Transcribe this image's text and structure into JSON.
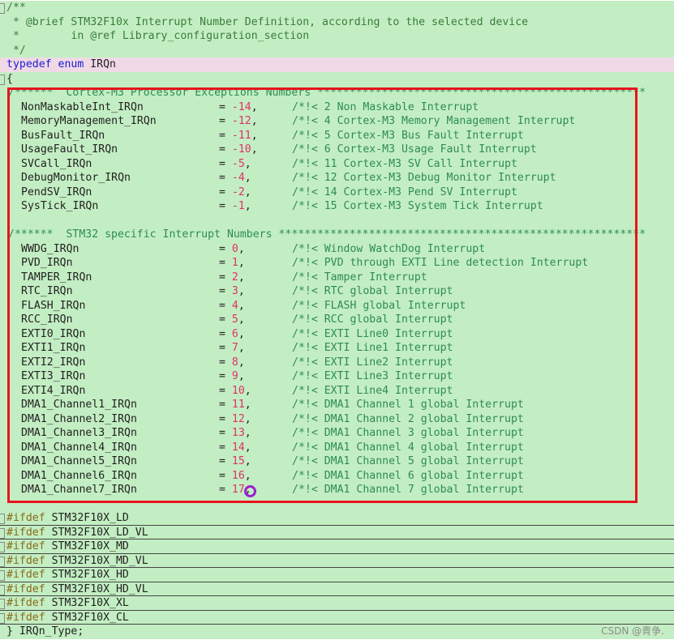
{
  "header_comment": [
    "/**",
    " * @brief STM32F10x Interrupt Number Definition, according to the selected device",
    " *        in @ref Library_configuration_section",
    " */"
  ],
  "typedef_line": {
    "keyword": "typedef enum",
    "name": " IRQn"
  },
  "open_brace": "{",
  "cortex_section_comment": "/******  Cortex-M3 Processor Exceptions Numbers ***************************************************",
  "cortex_entries": [
    {
      "name": "NonMaskableInt_IRQn",
      "value": "-14",
      "comment": "/*!< 2 Non Maskable Interrupt"
    },
    {
      "name": "MemoryManagement_IRQn",
      "value": "-12",
      "comment": "/*!< 4 Cortex-M3 Memory Management Interrupt"
    },
    {
      "name": "BusFault_IRQn",
      "value": "-11",
      "comment": "/*!< 5 Cortex-M3 Bus Fault Interrupt"
    },
    {
      "name": "UsageFault_IRQn",
      "value": "-10",
      "comment": "/*!< 6 Cortex-M3 Usage Fault Interrupt"
    },
    {
      "name": "SVCall_IRQn",
      "value": "-5",
      "comment": "/*!< 11 Cortex-M3 SV Call Interrupt"
    },
    {
      "name": "DebugMonitor_IRQn",
      "value": "-4",
      "comment": "/*!< 12 Cortex-M3 Debug Monitor Interrupt"
    },
    {
      "name": "PendSV_IRQn",
      "value": "-2",
      "comment": "/*!< 14 Cortex-M3 Pend SV Interrupt"
    },
    {
      "name": "SysTick_IRQn",
      "value": "-1",
      "comment": "/*!< 15 Cortex-M3 System Tick Interrupt"
    }
  ],
  "stm32_section_comment": "/******  STM32 specific Interrupt Numbers *********************************************************",
  "stm32_entries": [
    {
      "name": "WWDG_IRQn",
      "value": "0",
      "comment": "/*!< Window WatchDog Interrupt"
    },
    {
      "name": "PVD_IRQn",
      "value": "1",
      "comment": "/*!< PVD through EXTI Line detection Interrupt"
    },
    {
      "name": "TAMPER_IRQn",
      "value": "2",
      "comment": "/*!< Tamper Interrupt"
    },
    {
      "name": "RTC_IRQn",
      "value": "3",
      "comment": "/*!< RTC global Interrupt"
    },
    {
      "name": "FLASH_IRQn",
      "value": "4",
      "comment": "/*!< FLASH global Interrupt"
    },
    {
      "name": "RCC_IRQn",
      "value": "5",
      "comment": "/*!< RCC global Interrupt"
    },
    {
      "name": "EXTI0_IRQn",
      "value": "6",
      "comment": "/*!< EXTI Line0 Interrupt"
    },
    {
      "name": "EXTI1_IRQn",
      "value": "7",
      "comment": "/*!< EXTI Line1 Interrupt"
    },
    {
      "name": "EXTI2_IRQn",
      "value": "8",
      "comment": "/*!< EXTI Line2 Interrupt"
    },
    {
      "name": "EXTI3_IRQn",
      "value": "9",
      "comment": "/*!< EXTI Line3 Interrupt"
    },
    {
      "name": "EXTI4_IRQn",
      "value": "10",
      "comment": "/*!< EXTI Line4 Interrupt"
    },
    {
      "name": "DMA1_Channel1_IRQn",
      "value": "11",
      "comment": "/*!< DMA1 Channel 1 global Interrupt"
    },
    {
      "name": "DMA1_Channel2_IRQn",
      "value": "12",
      "comment": "/*!< DMA1 Channel 2 global Interrupt"
    },
    {
      "name": "DMA1_Channel3_IRQn",
      "value": "13",
      "comment": "/*!< DMA1 Channel 3 global Interrupt"
    },
    {
      "name": "DMA1_Channel4_IRQn",
      "value": "14",
      "comment": "/*!< DMA1 Channel 4 global Interrupt"
    },
    {
      "name": "DMA1_Channel5_IRQn",
      "value": "15",
      "comment": "/*!< DMA1 Channel 5 global Interrupt"
    },
    {
      "name": "DMA1_Channel6_IRQn",
      "value": "16",
      "comment": "/*!< DMA1 Channel 6 global Interrupt"
    },
    {
      "name": "DMA1_Channel7_IRQn",
      "value": "17",
      "comment": "/*!< DMA1 Channel 7 global Interrupt"
    }
  ],
  "ifdef_blocks": [
    {
      "directive": "#ifdef",
      "macro": " STM32F10X_LD"
    },
    {
      "directive": "#ifdef",
      "macro": " STM32F10X_LD_VL"
    },
    {
      "directive": "#ifdef",
      "macro": " STM32F10X_MD"
    },
    {
      "directive": "#ifdef",
      "macro": " STM32F10X_MD_VL"
    },
    {
      "directive": "#ifdef",
      "macro": " STM32F10X_HD"
    },
    {
      "directive": "#ifdef",
      "macro": " STM32F10X_HD_VL"
    },
    {
      "directive": "#ifdef",
      "macro": " STM32F10X_XL"
    },
    {
      "directive": "#ifdef",
      "macro": " STM32F10X_CL"
    }
  ],
  "closing_line": "} IRQn_Type;",
  "watermark": "CSDN @青争.",
  "colors": {
    "code_background": "#c3eec3",
    "typedef_highlight": "#f0d9e6",
    "annotation_box": "#e8141e",
    "cursor_circle": "#9b1fd1"
  }
}
